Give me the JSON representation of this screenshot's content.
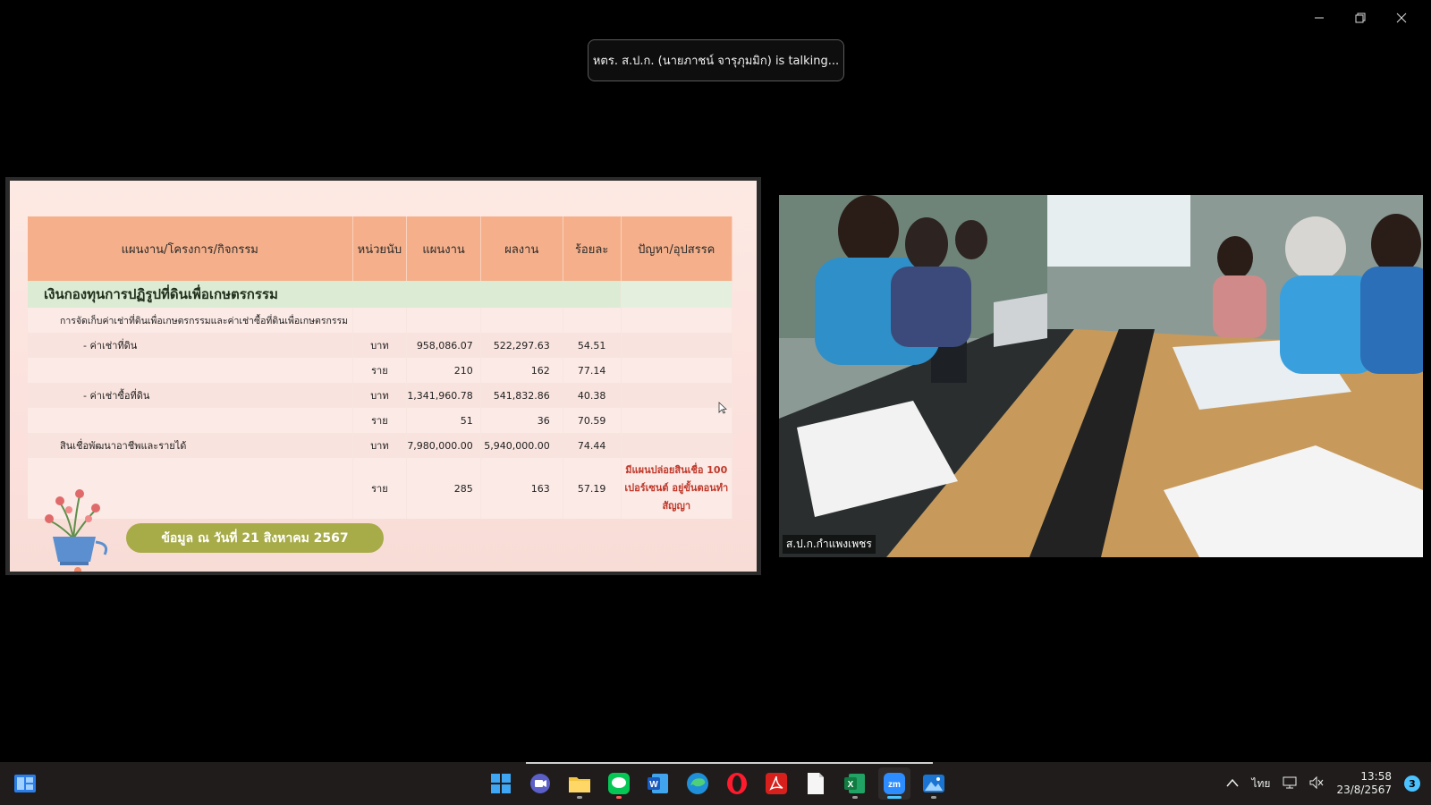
{
  "banner": {
    "talking_text": "หตร. ส.ป.ก. (นายภาชน์  จารุภุมมิก) is talking..."
  },
  "slide": {
    "headers": {
      "activity": "แผนงาน/โครงการ/กิจกรรม",
      "unit": "หน่วยนับ",
      "plan": "แผนงาน",
      "result": "ผลงาน",
      "percent": "ร้อยละ",
      "issue": "ปัญหา/อุปสรรค"
    },
    "section_title": "เงินกองทุนการปฏิรูปที่ดินเพื่อเกษตรกรรม",
    "rows": [
      {
        "label": "การจัดเก็บค่าเช่าที่ดินเพื่อเกษตรกรรมและค่าเช่าซื้อที่ดินเพื่อเกษตรกรรม",
        "unit": "",
        "plan": "",
        "result": "",
        "percent": "",
        "issue": ""
      },
      {
        "label": "- ค่าเช่าที่ดิน",
        "unit": "บาท",
        "plan": "958,086.07",
        "result": "522,297.63",
        "percent": "54.51",
        "issue": ""
      },
      {
        "label": "",
        "unit": "ราย",
        "plan": "210",
        "result": "162",
        "percent": "77.14",
        "issue": ""
      },
      {
        "label": "- ค่าเช่าซื้อที่ดิน",
        "unit": "บาท",
        "plan": "1,341,960.78",
        "result": "541,832.86",
        "percent": "40.38",
        "issue": ""
      },
      {
        "label": "",
        "unit": "ราย",
        "plan": "51",
        "result": "36",
        "percent": "70.59",
        "issue": ""
      },
      {
        "label": "สินเชื่อพัฒนาอาชีพและรายได้",
        "unit": "บาท",
        "plan": "7,980,000.00",
        "result": "5,940,000.00",
        "percent": "74.44",
        "issue": ""
      },
      {
        "label": "",
        "unit": "ราย",
        "plan": "285",
        "result": "163",
        "percent": "57.19",
        "issue": "มีแผนปล่อยสินเชื่อ 100 เปอร์เซนต์ อยู่ขั้นตอนทำสัญญา"
      }
    ],
    "date_note": "ข้อมูล ณ วันที่ 21 สิงหาคม 2567"
  },
  "video": {
    "participant_name": "ส.ป.ก.กำแพงเพชร"
  },
  "taskbar": {
    "apps": [
      "windows-start",
      "zoom-meetings",
      "file-explorer",
      "line",
      "word",
      "edge",
      "opera",
      "acrobat",
      "notepad",
      "excel",
      "zoom",
      "photos"
    ],
    "language": "ไทย",
    "time": "13:58",
    "date": "23/8/2567",
    "notification_count": "3"
  },
  "colors": {
    "header_bg": "#f5b08b",
    "section_bg": "#dcebd4",
    "issue_text": "#c0392b",
    "date_pill": "#a7ab48"
  }
}
